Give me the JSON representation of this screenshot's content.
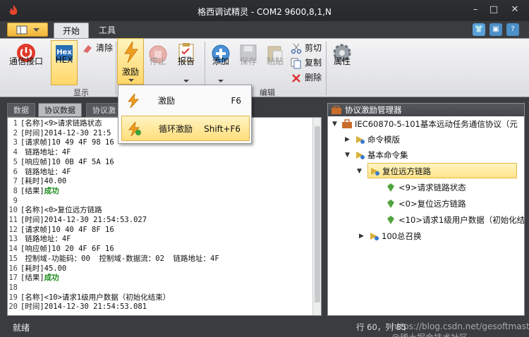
{
  "window": {
    "title": "格西调试精灵 - COM2  9600,8,1,N",
    "min": "–",
    "max": "□",
    "close": "✕"
  },
  "ribbon_tabs": [
    "开始",
    "工具"
  ],
  "ribbon": {
    "comm_port": "通信接口",
    "hex": "HEX",
    "hex_logo": "Hex",
    "clear": "清除",
    "group_display": "显示",
    "excite": "激励",
    "stop": "停止",
    "report": "报告",
    "add": "添加",
    "save": "保存",
    "paste": "粘贴",
    "cut": "剪切",
    "copy": "复制",
    "delete": "删除",
    "group_edit": "编辑",
    "properties": "属性"
  },
  "menu": {
    "items": [
      {
        "label": "激励",
        "shortcut": "F6"
      },
      {
        "label": "循环激励",
        "shortcut": "Shift+F6"
      }
    ]
  },
  "left_tabs": [
    "数据",
    "协议数据",
    "协议激"
  ],
  "log": [
    {
      "n": "1",
      "t": "[名称]<9>请求链路状态"
    },
    {
      "n": "2",
      "t": "[时间]2014-12-30 21:5"
    },
    {
      "n": "3",
      "t": "[请求帧]10 49 4F 98 16"
    },
    {
      "n": "4",
      "t": " 链路地址：4F"
    },
    {
      "n": "5",
      "t": "[响应帧]10 0B 4F 5A 16"
    },
    {
      "n": "6",
      "t": " 链路地址：4F"
    },
    {
      "n": "7",
      "t": "[耗时]40.00"
    },
    {
      "n": "8",
      "t": "[结果]",
      "ok": "成功"
    },
    {
      "n": "9",
      "t": ""
    },
    {
      "n": "10",
      "t": "[名称]<0>复位远方链路"
    },
    {
      "n": "11",
      "t": "[时间]2014-12-30 21:54:53.027"
    },
    {
      "n": "12",
      "t": "[请求帧]10 40 4F 8F 16"
    },
    {
      "n": "13",
      "t": " 链路地址：4F"
    },
    {
      "n": "14",
      "t": "[响应帧]10 20 4F 6F 16"
    },
    {
      "n": "15",
      "t": " 控制域-功能码：00  控制域-数据流：02  链路地址：4F"
    },
    {
      "n": "16",
      "t": "[耗时]45.00"
    },
    {
      "n": "17",
      "t": "[结果]",
      "ok": "成功"
    },
    {
      "n": "18",
      "t": ""
    },
    {
      "n": "19",
      "t": "[名称]<10>请求1级用户数据（初始化结束）"
    },
    {
      "n": "20",
      "t": "[时间]2014-12-30 21:54:53.081"
    }
  ],
  "right_panel": {
    "title": "协议激励管理器",
    "tree": {
      "root": "IEC60870-5-101基本远动任务通信协议（元",
      "templates": "命令模版",
      "basic": "基本命令集",
      "reset": "复位远方链路",
      "leaf1": "<9>请求链路状态",
      "leaf2": "<0>复位远方链路",
      "leaf3": "<10>请求1级用户数据（初始化结",
      "general": "100总召换"
    }
  },
  "status": {
    "left": "就绪",
    "right": "行 60，列 85",
    "watermark": "https://blog.csdn.net/gesoftmaster  @稀土掘金技术社区"
  }
}
